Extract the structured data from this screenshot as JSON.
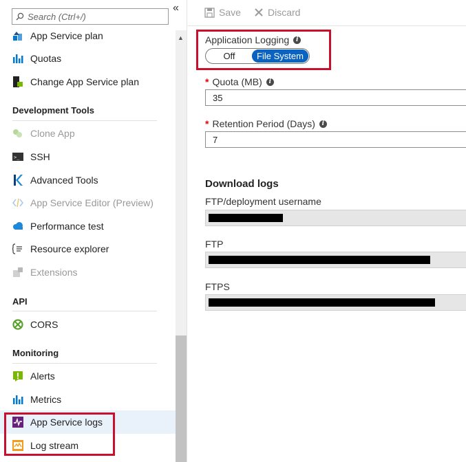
{
  "nav": {
    "search_placeholder": "Search (Ctrl+/)",
    "collapse_glyph": "«",
    "items_top": [
      {
        "label": "App Service plan",
        "icon": "app-service-plan-icon"
      },
      {
        "label": "Quotas",
        "icon": "quotas-icon"
      },
      {
        "label": "Change App Service plan",
        "icon": "change-plan-icon"
      }
    ],
    "sections": {
      "dev_tools": "Development Tools",
      "api": "API",
      "monitoring": "Monitoring"
    },
    "dev_tools_items": [
      {
        "label": "Clone App",
        "disabled": true
      },
      {
        "label": "SSH",
        "disabled": false
      },
      {
        "label": "Advanced Tools",
        "disabled": false
      },
      {
        "label": "App Service Editor (Preview)",
        "disabled": true
      },
      {
        "label": "Performance test",
        "disabled": false
      },
      {
        "label": "Resource explorer",
        "disabled": false
      },
      {
        "label": "Extensions",
        "disabled": true
      }
    ],
    "api_items": [
      {
        "label": "CORS"
      }
    ],
    "monitoring_items": [
      {
        "label": "Alerts"
      },
      {
        "label": "Metrics"
      },
      {
        "label": "App Service logs",
        "selected": true
      },
      {
        "label": "Log stream"
      }
    ]
  },
  "toolbar": {
    "save_label": "Save",
    "discard_label": "Discard"
  },
  "form": {
    "app_logging_label": "Application Logging",
    "toggle_off": "Off",
    "toggle_on": "File System",
    "toggle_selected": "File System",
    "quota_label": "Quota (MB)",
    "quota_value": "35",
    "retention_label": "Retention Period (Days)",
    "retention_value": "7",
    "download_heading": "Download logs",
    "ftp_user_label": "FTP/deployment username",
    "ftp_label": "FTP",
    "ftps_label": "FTPS"
  },
  "colors": {
    "accent": "#0a63c0",
    "highlight_border": "#c8102e",
    "selected_bg": "#e9f1fb",
    "required": "#e00000"
  }
}
